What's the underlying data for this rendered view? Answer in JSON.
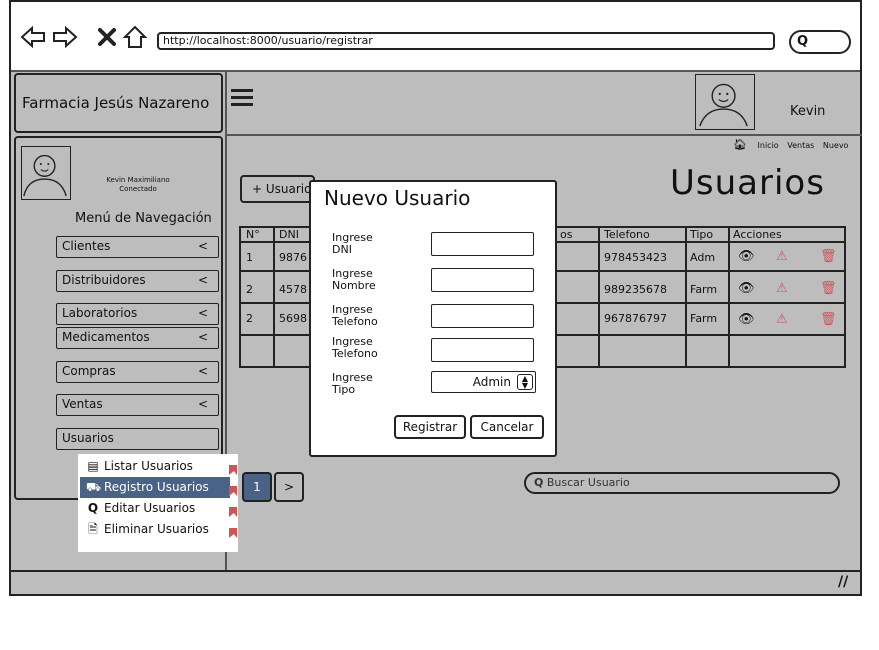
{
  "browser": {
    "url": "http://localhost:8000/usuario/registrar",
    "search_icon_text": "Q"
  },
  "header": {
    "brand": "Farmacia Jesús Nazareno",
    "username": "Kevin",
    "breadcrumbs": [
      "Inicio",
      "Ventas",
      "Nuevo"
    ]
  },
  "page": {
    "title": "Usuarios"
  },
  "sidebar": {
    "user_name": "Kevin Maximiliano",
    "user_status": "Conectado",
    "menu_heading": "Menú de Navegación",
    "items": [
      {
        "label": "Clientes",
        "chevron": "<"
      },
      {
        "label": "Distribuidores",
        "chevron": "<"
      },
      {
        "label": "Laboratorios",
        "chevron": "<"
      },
      {
        "label": "Medicamentos",
        "chevron": "<"
      },
      {
        "label": "Compras",
        "chevron": "<"
      },
      {
        "label": "Ventas",
        "chevron": "<"
      },
      {
        "label": "Usuarios"
      }
    ],
    "submenu": [
      {
        "label": "Listar Usuarios",
        "icon": "list-icon"
      },
      {
        "label": "Registro Usuarios",
        "icon": "cart-icon",
        "selected": true
      },
      {
        "label": "Editar Usuarios",
        "icon": "search-icon"
      },
      {
        "label": "Eliminar Usuarios",
        "icon": "document-icon"
      }
    ]
  },
  "main": {
    "add_button": "+ Usuario",
    "table": {
      "headers": {
        "n": "N°",
        "dni": "DNI",
        "apellidos": "os",
        "telefono": "Telefono",
        "tipo": "Tipo",
        "acciones": "Acciones"
      },
      "rows": [
        {
          "n": "1",
          "dni": "9876",
          "telefono": "978453423",
          "tipo": "Adm"
        },
        {
          "n": "2",
          "dni": "4578",
          "telefono": "989235678",
          "tipo": "Farm"
        },
        {
          "n": "2",
          "dni": "5698",
          "telefono": "967876797",
          "tipo": "Farm"
        }
      ]
    },
    "pagination": {
      "current": "1",
      "next": ">"
    },
    "search_placeholder": "Buscar Usuario"
  },
  "modal": {
    "title": "Nuevo Usuario",
    "labels": {
      "dni": [
        "Ingrese",
        "DNI"
      ],
      "nombre": [
        "Ingrese",
        "Nombre"
      ],
      "telefono1": [
        "Ingrese",
        "Telefono"
      ],
      "telefono2": [
        "Ingrese",
        "Telefono"
      ],
      "tipo": [
        "Ingrese",
        "Tipo"
      ]
    },
    "tipo_selected": "Admin",
    "register_button": "Registrar",
    "cancel_button": "Cancelar"
  },
  "colors": {
    "background": "#bdbdbd",
    "selection": "#4a6285",
    "danger": "#cc5555"
  }
}
